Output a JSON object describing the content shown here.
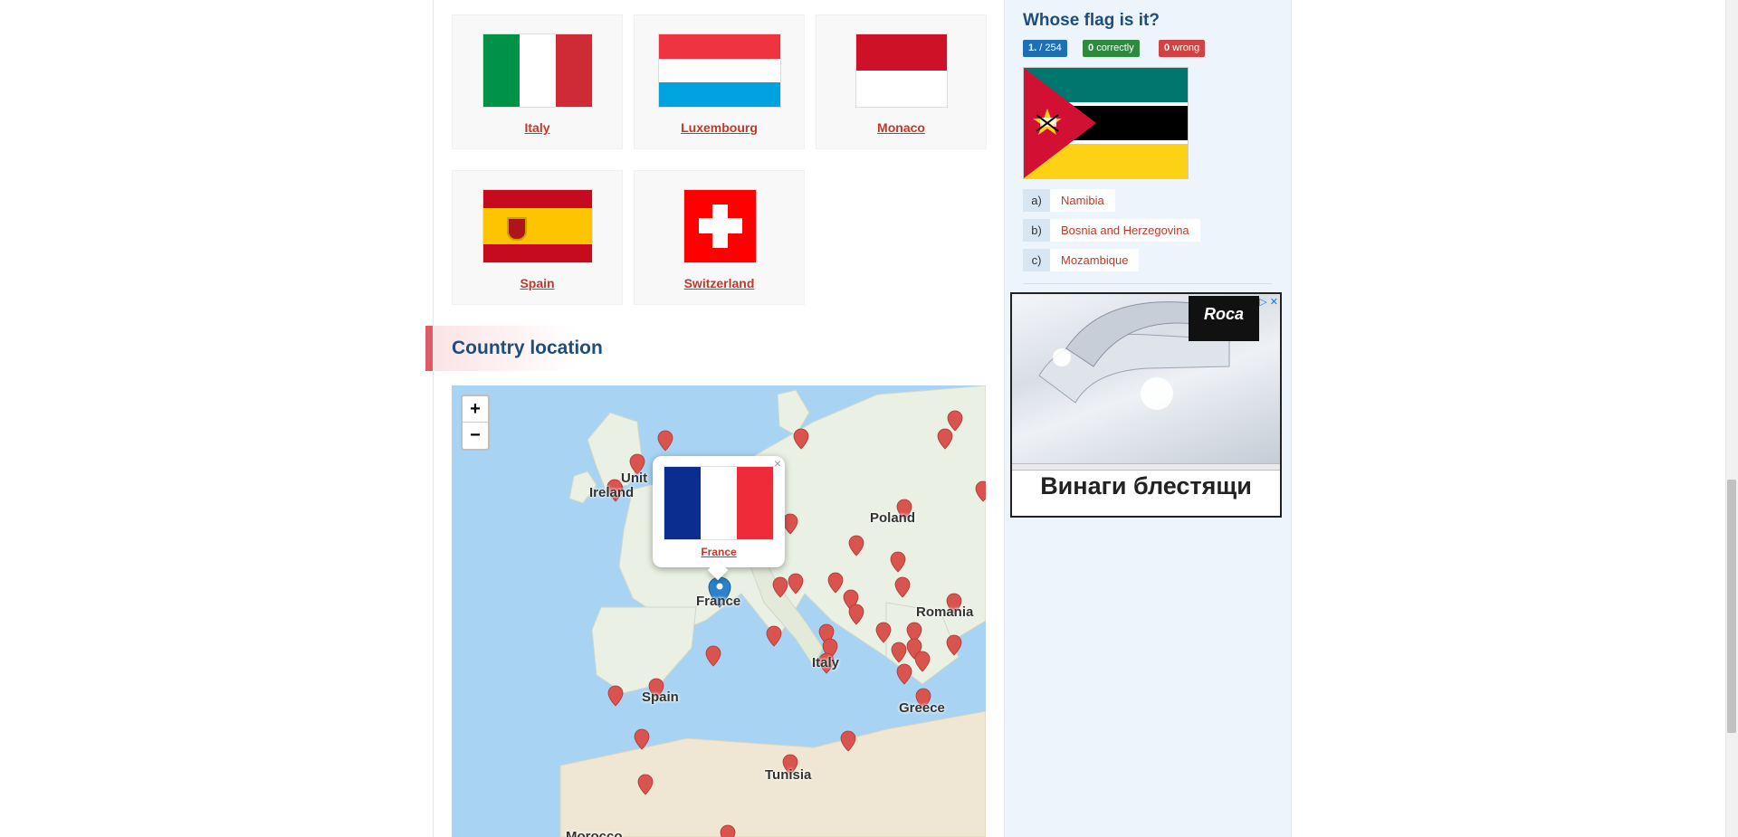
{
  "neighbors": {
    "cards": [
      {
        "name": "Italy"
      },
      {
        "name": "Luxembourg"
      },
      {
        "name": "Monaco"
      },
      {
        "name": "Spain"
      },
      {
        "name": "Switzerland"
      }
    ]
  },
  "location": {
    "title": "Country location",
    "zoom_in": "+",
    "zoom_out": "−",
    "labels": {
      "uk": "Unit",
      "ireland": "Ireland",
      "poland": "Poland",
      "france": "France",
      "romania": "Romania",
      "italy": "Italy",
      "spain": "Spain",
      "greece": "Greece",
      "tunisia": "Tunisia",
      "morocco": "Morocco"
    },
    "popup": {
      "country": "France",
      "close": "×"
    }
  },
  "quiz": {
    "title": "Whose flag is it?",
    "progress": "1.",
    "progress_total": "/ 254",
    "correct_count": "0",
    "correct_label": "correctly",
    "wrong_count": "0",
    "wrong_label": "wrong",
    "options": [
      {
        "letter": "a)",
        "text": "Namibia"
      },
      {
        "letter": "b)",
        "text": "Bosnia and Herzegovina"
      },
      {
        "letter": "c)",
        "text": "Mozambique"
      }
    ]
  },
  "ad": {
    "brand": "Roca",
    "tagline": "Винаги блестящи",
    "choices": "▷ ✕"
  },
  "colors": {
    "link": "#c0392b",
    "heading": "#1d4e7c",
    "badge_progress": "#1f6fb5",
    "badge_correct": "#2e8b3d",
    "badge_wrong": "#d14343",
    "marker": "#d9534f",
    "marker_active": "#2b82cb"
  }
}
